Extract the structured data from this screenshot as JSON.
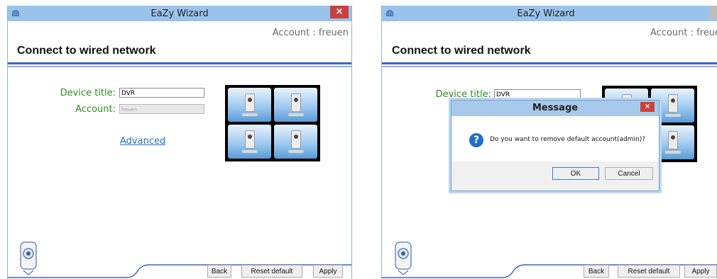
{
  "window": {
    "title": "EaZy Wizard",
    "close_glyph": "×"
  },
  "header": {
    "account": "Account : freuen",
    "heading": "Connect to wired network"
  },
  "form": {
    "device_title_label": "Device title:",
    "device_title_value": "DVR",
    "account_label": "Account:",
    "account_value": "freuen",
    "advanced_link": "Advanced"
  },
  "preview": {
    "layout": "2x2",
    "icon": "camera-icon"
  },
  "footer": {
    "back": "Back",
    "reset": "Reset default",
    "apply": "Apply"
  },
  "dialog": {
    "title": "Message",
    "close_glyph": "×",
    "icon": "question-icon",
    "icon_glyph": "?",
    "message": "Do you want to remove default account(admin)?",
    "ok": "OK",
    "cancel": "Cancel"
  },
  "colors": {
    "titlebar": "#9ac3ec",
    "label_green": "#2e8a1e",
    "link_blue": "#1f6fc6",
    "close_red": "#c9413c"
  }
}
